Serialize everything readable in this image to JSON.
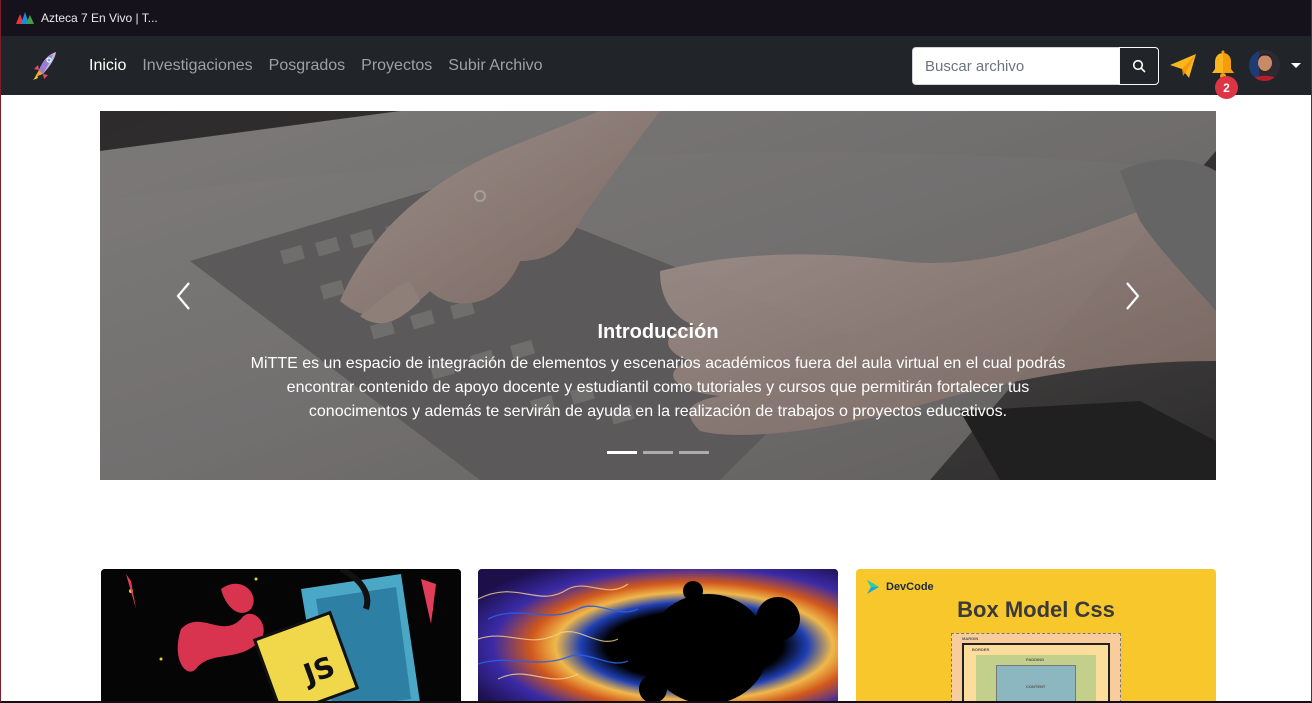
{
  "browser": {
    "tab_title": "Azteca 7 En Vivo | T..."
  },
  "navbar": {
    "brand_icon": "rocket-icon",
    "links": [
      {
        "label": "Inicio",
        "active": true
      },
      {
        "label": "Investigaciones",
        "active": false
      },
      {
        "label": "Posgrados",
        "active": false
      },
      {
        "label": "Proyectos",
        "active": false
      },
      {
        "label": "Subir Archivo",
        "active": false
      }
    ],
    "search": {
      "placeholder": "Buscar archivo",
      "value": "",
      "button_icon": "search-icon"
    },
    "send_icon": "paper-plane-icon",
    "notifications": {
      "icon": "bell-icon",
      "count": "2"
    },
    "user": {
      "icon": "avatar"
    }
  },
  "carousel": {
    "caption_title": "Introducción",
    "caption_text": "MiTTE es un espacio de integración de elementos y escenarios académicos fuera del aula virtual en el cual podrás encontrar contenido de apoyo docente y estudiantil como tutoriales y cursos que permitirán fortalecer tus conocimentos y además te servirán de ayuda en la realización de trabajos o proyectos educativos.",
    "slides_count": 3,
    "active_slide": 1,
    "prev_icon": "chevron-left-icon",
    "next_icon": "chevron-right-icon"
  },
  "cards": [
    {
      "image": "javascript-illustration",
      "badge_text": "JS"
    },
    {
      "image": "fractal-illustration"
    },
    {
      "image": "box-model-illustration",
      "brand": "DevCode",
      "title": "Box Model Css",
      "layers": [
        "MARGIN",
        "BORDER",
        "PADDING",
        "CONTENT"
      ]
    }
  ],
  "colors": {
    "navbar_bg": "#212529",
    "titlebar_bg": "#16121c",
    "badge": "#dc3545",
    "accent_yellow": "#f7c72b"
  }
}
